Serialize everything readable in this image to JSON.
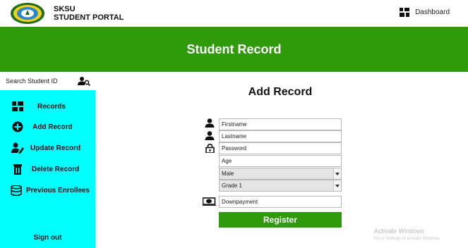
{
  "topbar": {
    "brand_line1": "SKSU",
    "brand_line2": "STUDENT PORTAL",
    "dashboard_label": "Dashboard"
  },
  "header": {
    "title": "Student Record"
  },
  "search": {
    "placeholder": "Search Student ID"
  },
  "sidebar": {
    "items": [
      {
        "label": "Records",
        "icon": "dashboard-grid-icon"
      },
      {
        "label": "Add Record",
        "icon": "plus-circle-icon"
      },
      {
        "label": "Update Record",
        "icon": "edit-user-icon"
      },
      {
        "label": "Delete Record",
        "icon": "trash-icon"
      },
      {
        "label": "Previous Enrollees",
        "icon": "database-icon"
      }
    ],
    "signout_label": "Sign out"
  },
  "form": {
    "title": "Add Record",
    "firstname_placeholder": "Firstname",
    "lastname_placeholder": "Lastname",
    "password_placeholder": "Password",
    "age_placeholder": "Age",
    "gender_value": "Male",
    "grade_value": "Grade 1",
    "downpayment_placeholder": "Downpayment",
    "register_label": "Register"
  },
  "watermark": {
    "line1": "Activate Windows",
    "line2": "Go to Settings to activate Windows."
  },
  "colors": {
    "header_green": "#2e9a0c",
    "sidebar_cyan": "#00ffff"
  }
}
